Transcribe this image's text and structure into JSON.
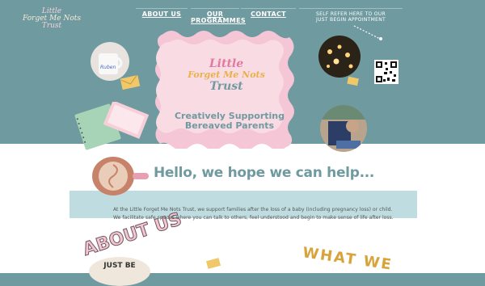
{
  "logo": {
    "lines": [
      "Little",
      "Forget Me Nots",
      "Trust"
    ]
  },
  "nav": {
    "about": "ABOUT US",
    "programmes_line1": "OUR",
    "programmes_line2": "PROGRAMMES",
    "contact": "CONTACT",
    "self_refer_line1": "SELF REFER HERE TO OUR",
    "self_refer_line2": "JUST BEGIN APPOINTMENT"
  },
  "hero": {
    "brand_line1": "Little",
    "brand_line2": "Forget Me Nots",
    "brand_line3": "Trust",
    "tagline_line1": "Creatively Supporting",
    "tagline_line2": "Bereaved Parents"
  },
  "mug_text": "Ruben",
  "hello": "Hello, we hope we can help...",
  "about": {
    "heading": "ABOUT US",
    "line1": "At the Little Forget Me Nots Trust, we support families after the loss of a baby (including pregnancy loss) or child.",
    "line2": "We facilitate safe spaces where you can talk to others, feel understood and begin to make sense of life after loss."
  },
  "what_we": "WHAT WE",
  "just_be": "JUST BE",
  "colors": {
    "teal": "#6f9aa0",
    "pink": "#f4c6d6",
    "mint": "#bfdde0",
    "gold": "#d8a43a"
  },
  "icons": [
    "envelope-icon",
    "qr-code-icon",
    "notebook-icon",
    "laptop-icon",
    "dotted-arrow-icon"
  ]
}
